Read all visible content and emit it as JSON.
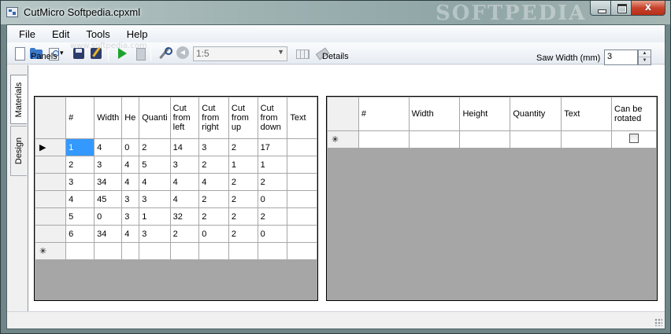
{
  "window": {
    "title": "CutMicro Softpedia.cpxml",
    "watermark": "SOFTPEDIA",
    "close_glyph": "x"
  },
  "menu": [
    "File",
    "Edit",
    "Tools",
    "Help"
  ],
  "toolbar": {
    "zoom_value": "1:5"
  },
  "tabs": [
    "Materials",
    "Design"
  ],
  "panels": {
    "label": "Panels",
    "watermark": "www.softpedia.com",
    "columns": [
      "#",
      "Width",
      "He",
      "Quanti",
      "Cut from left",
      "Cut from right",
      "Cut from up",
      "Cut from down",
      "Text"
    ],
    "rows": [
      [
        "1",
        "4",
        "0",
        "2",
        "14",
        "3",
        "2",
        "17",
        ""
      ],
      [
        "2",
        "3",
        "4",
        "5",
        "3",
        "2",
        "1",
        "1",
        ""
      ],
      [
        "3",
        "34",
        "4",
        "4",
        "4",
        "4",
        "2",
        "2",
        ""
      ],
      [
        "4",
        "45",
        "3",
        "3",
        "4",
        "2",
        "2",
        "0",
        ""
      ],
      [
        "5",
        "0",
        "3",
        "1",
        "32",
        "2",
        "2",
        "2",
        ""
      ],
      [
        "6",
        "34",
        "4",
        "3",
        "2",
        "0",
        "2",
        "0",
        ""
      ]
    ],
    "current_row_glyph": "▶",
    "new_row_glyph": "✳"
  },
  "details": {
    "label": "Details",
    "saw_width_label": "Saw Width (mm)",
    "saw_width_value": "3",
    "columns": [
      "#",
      "Width",
      "Height",
      "Quantity",
      "Text",
      "Can be rotated"
    ],
    "new_row_glyph": "✳"
  },
  "colors": {
    "selection": "#3399ff",
    "grid_background": "#a6a6a6"
  }
}
